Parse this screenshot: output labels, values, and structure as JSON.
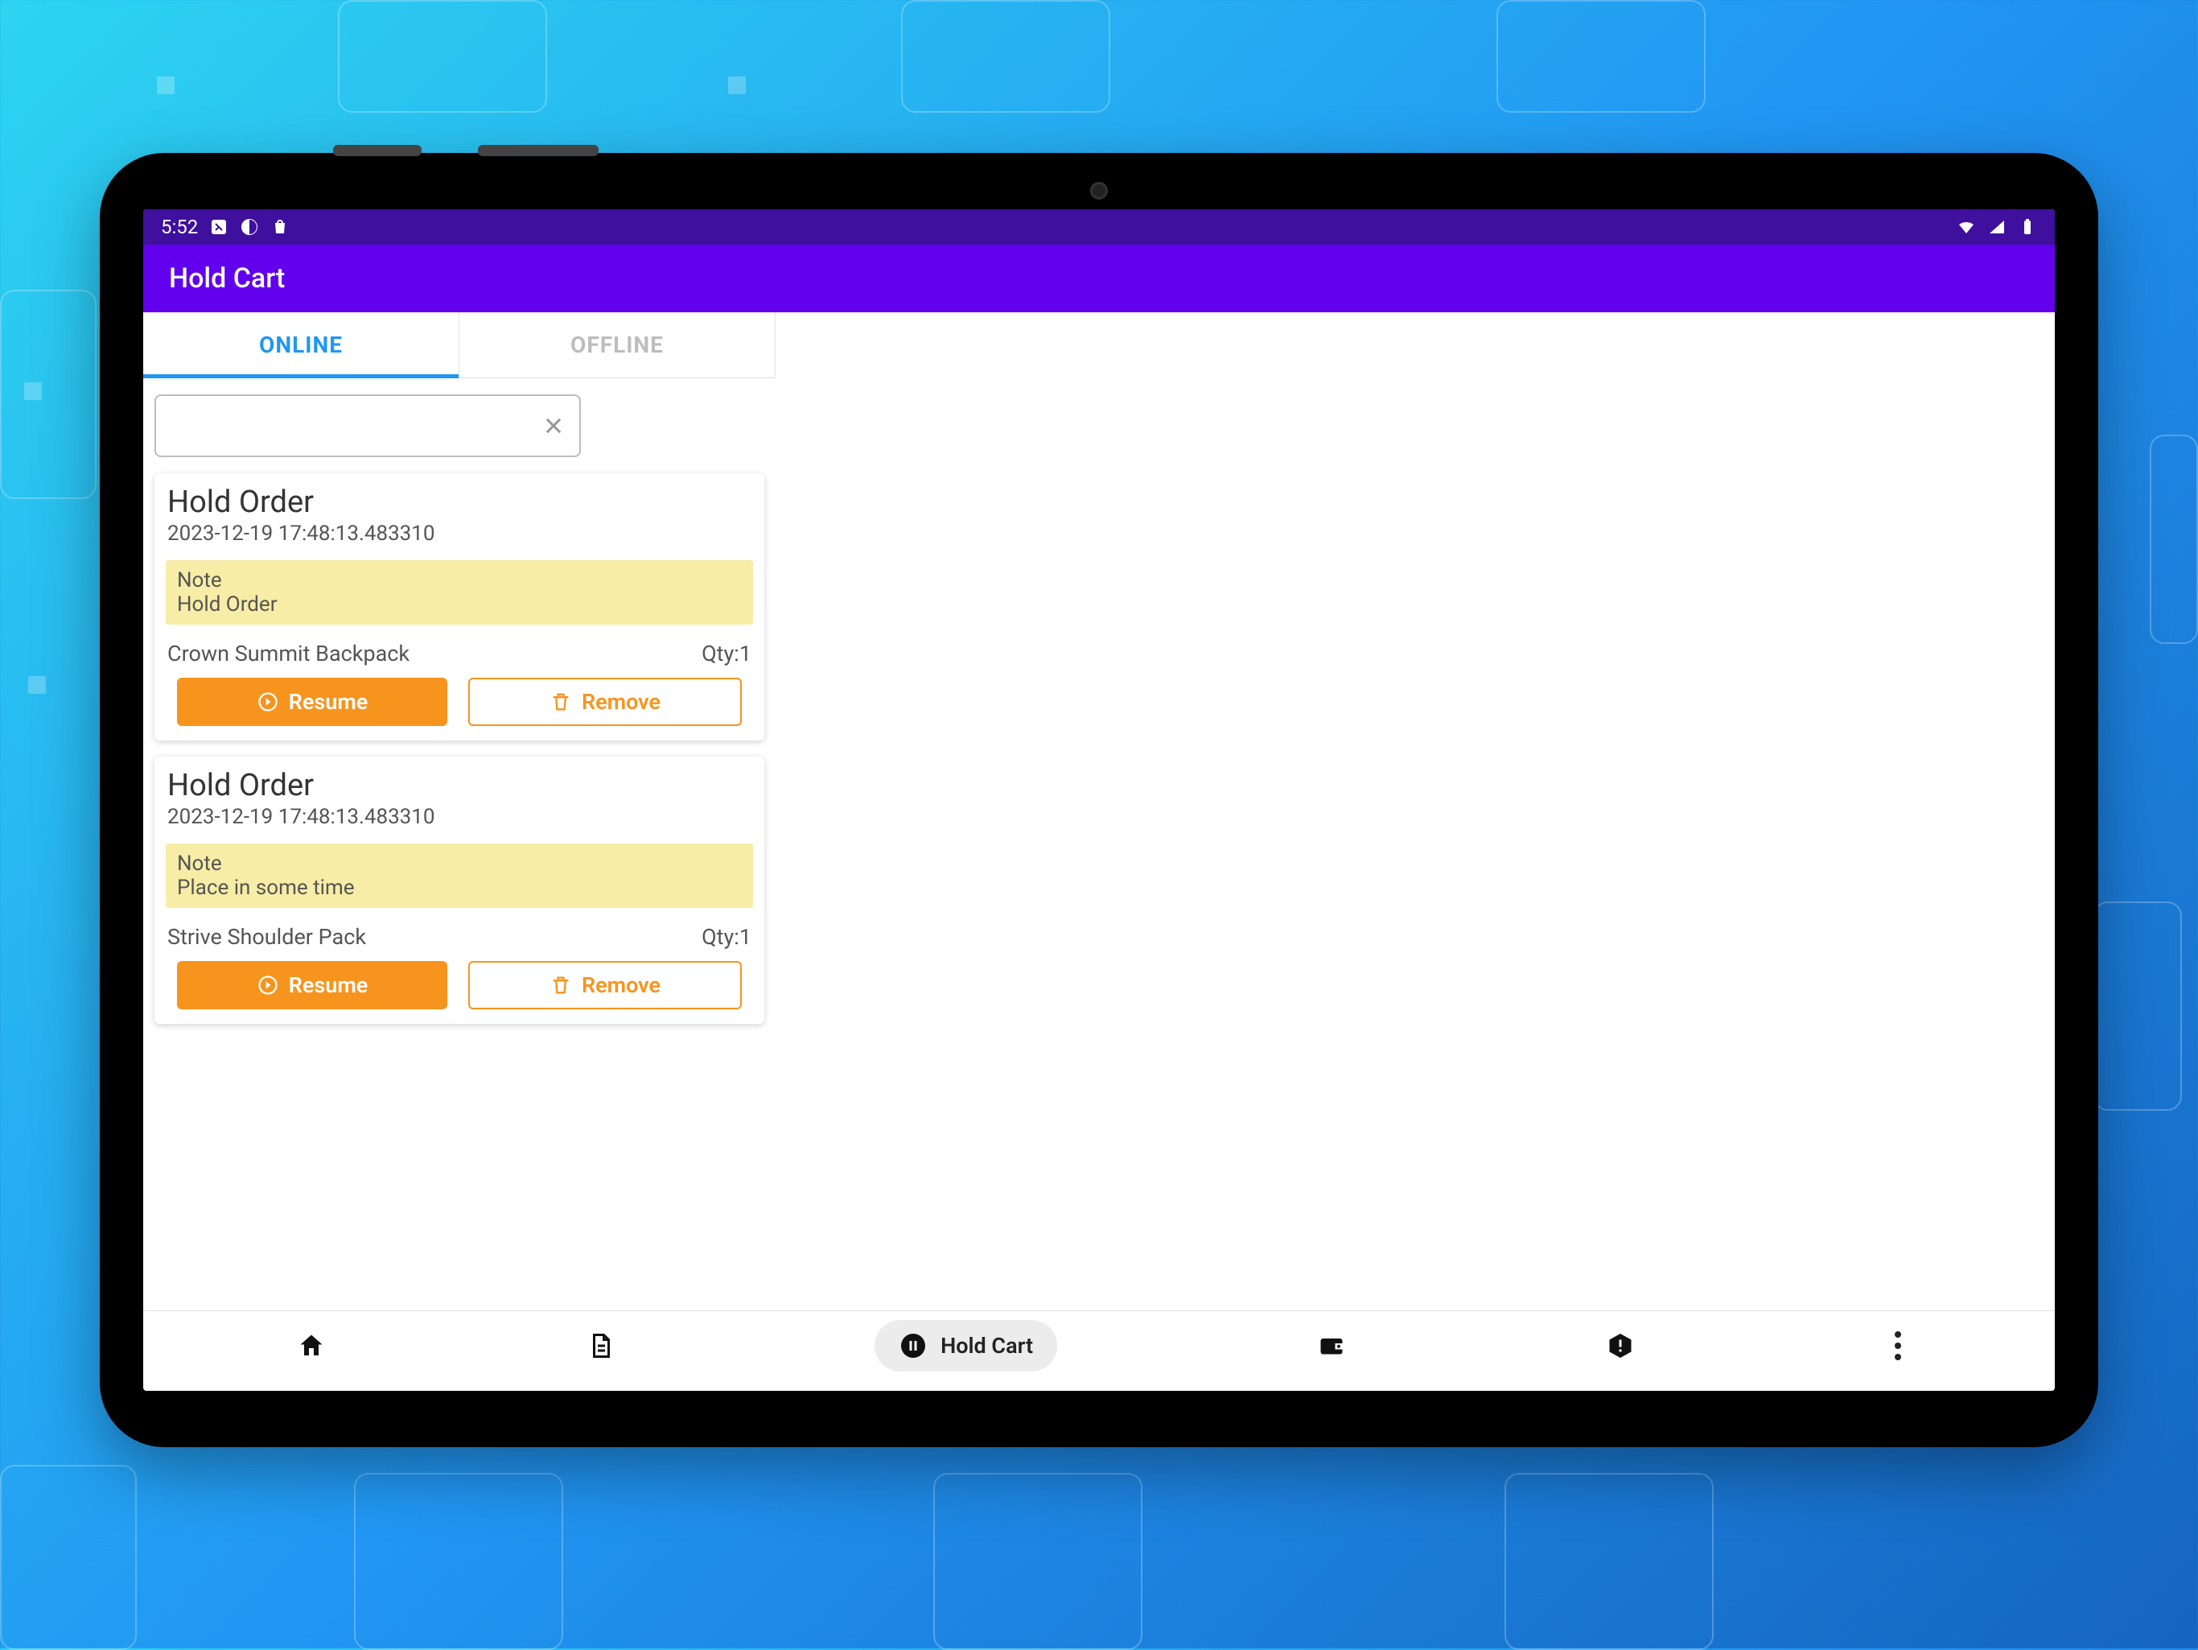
{
  "statusbar": {
    "time": "5:52"
  },
  "appbar": {
    "title": "Hold Cart"
  },
  "tabs": {
    "online": "ONLINE",
    "offline": "OFFLINE"
  },
  "search": {
    "value": ""
  },
  "orders": [
    {
      "title": "Hold Order",
      "timestamp": "2023-12-19 17:48:13.483310",
      "note_label": "Note",
      "note_text": "Hold Order",
      "product": "Crown Summit Backpack",
      "qty": "Qty:1",
      "resume": "Resume",
      "remove": "Remove"
    },
    {
      "title": "Hold Order",
      "timestamp": "2023-12-19 17:48:13.483310",
      "note_label": "Note",
      "note_text": "Place in some time",
      "product": "Strive Shoulder Pack",
      "qty": "Qty:1",
      "resume": "Resume",
      "remove": "Remove"
    }
  ],
  "bottomnav": {
    "hold_cart": "Hold Cart"
  }
}
